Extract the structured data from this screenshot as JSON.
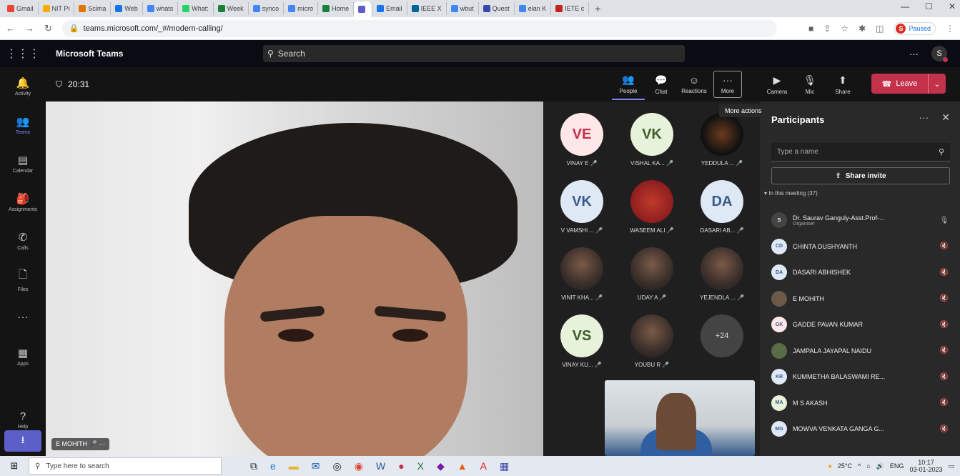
{
  "browser": {
    "tabs": [
      {
        "label": "Gmail",
        "color": "#ea4335"
      },
      {
        "label": "NIT Pi",
        "color": "#f9ab00"
      },
      {
        "label": "Scima",
        "color": "#e37400"
      },
      {
        "label": "Web",
        "color": "#1a73e8"
      },
      {
        "label": "whats",
        "color": "#4285f4"
      },
      {
        "label": "What:",
        "color": "#25d366"
      },
      {
        "label": "Week",
        "color": "#188038"
      },
      {
        "label": "synco",
        "color": "#4285f4"
      },
      {
        "label": "micro",
        "color": "#4285f4"
      },
      {
        "label": "Home",
        "color": "#188038"
      },
      {
        "label": "",
        "color": "#5b5fc7"
      },
      {
        "label": "Email",
        "color": "#1a73e8"
      },
      {
        "label": "IEEE X",
        "color": "#00629b"
      },
      {
        "label": "wbut",
        "color": "#4285f4"
      },
      {
        "label": "Quest",
        "color": "#3949ab"
      },
      {
        "label": "elan K",
        "color": "#4285f4"
      },
      {
        "label": "IETE c",
        "color": "#c5221f"
      }
    ],
    "new_tab": "+",
    "url": "teams.microsoft.com/_#/modern-calling/",
    "profile_status": "Paused",
    "profile_initial": "S"
  },
  "teams": {
    "app_name": "Microsoft Teams",
    "search_placeholder": "Search",
    "more_dots": "···",
    "user_initial": "S"
  },
  "rail": [
    {
      "label": "Activity",
      "icon": "bell-icon"
    },
    {
      "label": "Teams",
      "icon": "teams-icon",
      "active": true
    },
    {
      "label": "Calendar",
      "icon": "calendar-icon"
    },
    {
      "label": "Assignments",
      "icon": "assignments-icon"
    },
    {
      "label": "Calls",
      "icon": "phone-icon"
    },
    {
      "label": "Files",
      "icon": "file-icon"
    },
    {
      "label": "",
      "icon": "more-icon"
    },
    {
      "label": "Apps",
      "icon": "apps-icon"
    }
  ],
  "rail_help": "Help",
  "meeting": {
    "timer": "20:31",
    "toolbar": {
      "people": "People",
      "chat": "Chat",
      "reactions": "Reactions",
      "more": "More",
      "camera": "Camera",
      "mic": "Mic",
      "share": "Share",
      "leave": "Leave"
    },
    "tooltip": "More actions",
    "main_video_name": "E MOHITH"
  },
  "gallery": [
    {
      "initials": "VE",
      "name": "VINAY E",
      "style": "initials"
    },
    {
      "initials": "VK",
      "name": "VISHAL KA...",
      "style": "initials green"
    },
    {
      "initials": "",
      "name": "YEDDULA ...",
      "style": "photo dark"
    },
    {
      "initials": "VK",
      "name": "V VAMSHI ...",
      "style": "initials blue"
    },
    {
      "initials": "",
      "name": "WASEEM ALI",
      "style": "photo red"
    },
    {
      "initials": "DA",
      "name": "DASARI AB...",
      "style": "initials blue"
    },
    {
      "initials": "",
      "name": "VINIT KHA...",
      "style": "photo"
    },
    {
      "initials": "",
      "name": "UDAY A",
      "style": "photo"
    },
    {
      "initials": "",
      "name": "YEJENDLA ...",
      "style": "photo"
    },
    {
      "initials": "VS",
      "name": "VINAY KU...",
      "style": "initials green"
    },
    {
      "initials": "",
      "name": "YOUBU R",
      "style": "photo"
    },
    {
      "initials": "+24",
      "name": "",
      "style": "more"
    }
  ],
  "participants": {
    "title": "Participants",
    "search_placeholder": "Type a name",
    "share_invite": "Share invite",
    "section": "In this meeting (37)",
    "list": [
      {
        "initials": "S",
        "name": "Dr. Saurav Ganguly-Asst.Prof-...",
        "sub": "Organiser",
        "color": "#444"
      },
      {
        "initials": "CD",
        "name": "CHINTA DUSHYANTH",
        "sub": "",
        "color": "#dfe9f6"
      },
      {
        "initials": "DA",
        "name": "DASARI ABHISHEK",
        "sub": "",
        "color": "#dfe9f6"
      },
      {
        "initials": "",
        "name": "E MOHITH",
        "sub": "",
        "color": "#6b5a48"
      },
      {
        "initials": "GK",
        "name": "GADDE PAVAN KUMAR",
        "sub": "",
        "color": "#fde7e9"
      },
      {
        "initials": "",
        "name": "JAMPALA JAYAPAL NAIDU",
        "sub": "",
        "color": "#5a6b48"
      },
      {
        "initials": "KR",
        "name": "KUMMETHA BALASWAMI RE...",
        "sub": "",
        "color": "#dfe9f6"
      },
      {
        "initials": "MA",
        "name": "M S AKASH",
        "sub": "",
        "color": "#e7f2da"
      },
      {
        "initials": "MG",
        "name": "MOWVA VENKATA GANGA G...",
        "sub": "",
        "color": "#dfe9f6"
      }
    ]
  },
  "taskbar": {
    "search": "Type here to search",
    "weather": "25°C",
    "lang": "ENG",
    "time": "10:17",
    "date": "03-01-2023"
  }
}
